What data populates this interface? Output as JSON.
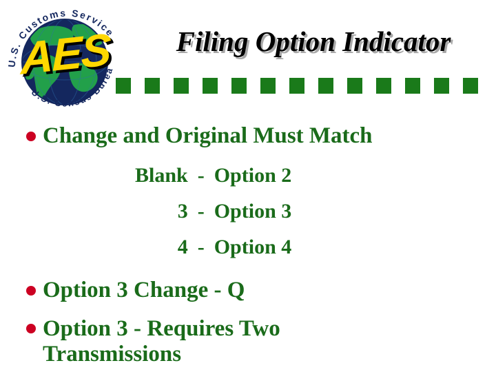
{
  "slide": {
    "title": "Filing Option Indicator",
    "background_color": "#ffffff"
  },
  "logo": {
    "name": "aes-seal",
    "acronym": "AES",
    "top_arc_text": "U.S. Customs Service",
    "bottom_arc_text": "U.S. Census Bureau",
    "colors": {
      "acronym": "#ffd700",
      "acronym_shadow": "#000000",
      "ocean": "#14275e",
      "land": "#22a04a",
      "arc_text": "#14275e"
    }
  },
  "divider": {
    "square_count": 13,
    "color": "#1a7a1a",
    "square_size": 22,
    "pitch": 42
  },
  "body": {
    "bullets": [
      {
        "id": "match",
        "text": "Change and Original Must Match"
      },
      {
        "id": "opt3change",
        "text": "Option 3 Change - Q"
      },
      {
        "id": "opt3two",
        "text": "Option 3 - Requires Two Transmissions"
      }
    ],
    "option_map": {
      "rows": [
        {
          "key": "Blank",
          "dash": "-",
          "value": "Option 2"
        },
        {
          "key": "3",
          "dash": "-",
          "value": "Option 3"
        },
        {
          "key": "4",
          "dash": "-",
          "value": "Option 4"
        }
      ]
    },
    "colors": {
      "text": "#1a6b1a",
      "bullet": "#cc0022",
      "title_text": "#000000",
      "title_shadow": "#a8a8a8"
    }
  }
}
